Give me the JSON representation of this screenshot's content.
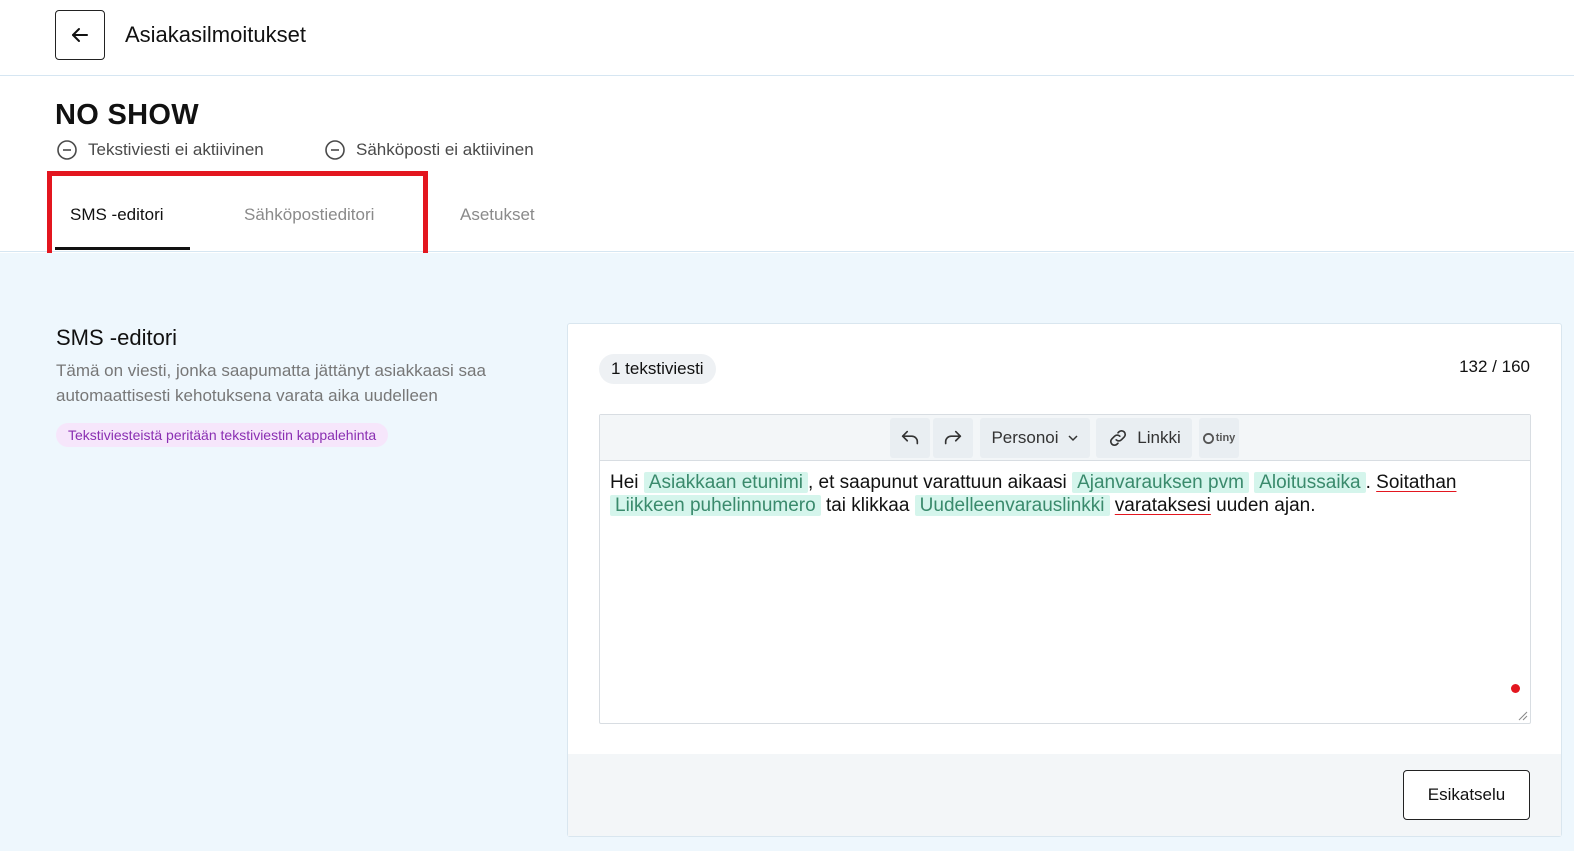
{
  "topbar": {
    "title": "Asiakasilmoitukset"
  },
  "header": {
    "title": "NO SHOW",
    "statuses": [
      {
        "label": "Tekstiviesti ei aktiivinen"
      },
      {
        "label": "Sähköposti ei aktiivinen"
      }
    ],
    "tabs": [
      {
        "label": "SMS -editori",
        "active": true
      },
      {
        "label": "Sähköpostieditori",
        "active": false
      },
      {
        "label": "Asetukset",
        "active": false
      }
    ]
  },
  "sms_section": {
    "title": "SMS -editori",
    "description": "Tämä on viesti, jonka saapumatta jättänyt asiakkaasi saa automaattisesti kehotuksena varata aika uudelleen",
    "price_note": "Tekstiviesteistä peritään tekstiviestin kappalehinta"
  },
  "editor": {
    "message_count": "1 tekstiviesti",
    "char_count": "132 / 160",
    "toolbar": {
      "personalize": "Personoi",
      "link": "Linkki",
      "brand": "tiny"
    },
    "content": {
      "t1": "Hei ",
      "tag_first_name": "Asiakkaan etunimi",
      "t2": ", et saapunut varattuun aikaasi ",
      "tag_date": "Ajanvarauksen pvm",
      "t3": " ",
      "tag_start": "Aloitussaika",
      "t4": ". ",
      "w_soitathan": "Soitathan",
      "t5": " ",
      "tag_phone": "Liikkeen puhelinnumero",
      "t6": " tai klikkaa ",
      "tag_rebook": "Uudelleenvarauslinkki",
      "t7": " ",
      "w_varataksesi": "varataksesi",
      "t8": " uuden ajan."
    }
  },
  "footer": {
    "preview_label": "Esikatselu"
  },
  "colors": {
    "highlight": "#e3161f",
    "tag_bg": "#d5f5ec",
    "tag_text": "#3a8a6c",
    "badge_bg": "#f6e6fb",
    "badge_text": "#8a2fb2",
    "page_bg": "#eef7fd"
  }
}
